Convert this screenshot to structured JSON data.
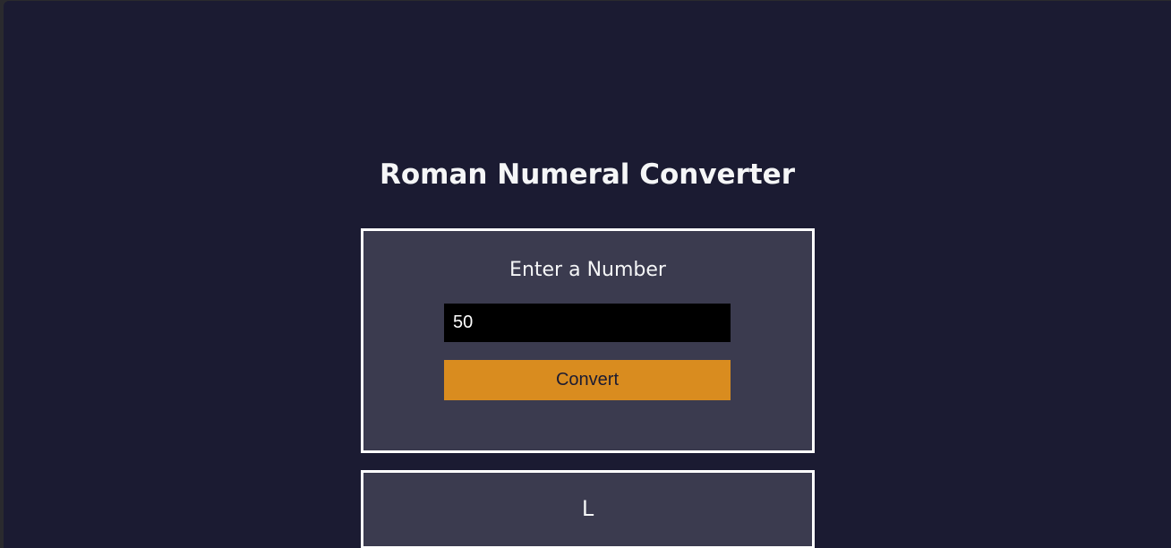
{
  "page": {
    "title": "Roman Numeral Converter"
  },
  "form": {
    "label": "Enter a Number",
    "input_value": "50",
    "convert_label": "Convert"
  },
  "output": {
    "result": "L"
  },
  "colors": {
    "background": "#1b1b32",
    "panel": "#3b3b4f",
    "accent": "#d98c1f",
    "input_bg": "#000000",
    "text": "#f5f6f7"
  }
}
